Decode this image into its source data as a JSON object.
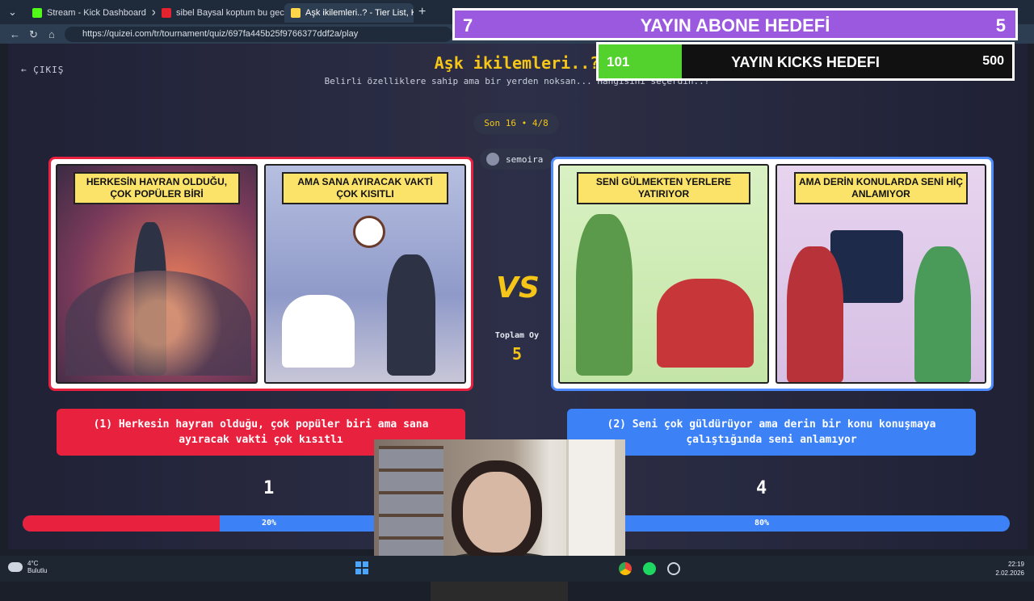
{
  "browser": {
    "tabs": [
      {
        "label": "Stream - Kick Dashboard",
        "active": false,
        "icon_color": "#53fc18"
      },
      {
        "label": "sibel Baysal koptum bu gece - You",
        "active": false,
        "icon_color": "#e5232e"
      },
      {
        "label": "Aşk ikilemleri..? - Tier List, Kör Sıral",
        "active": true,
        "icon_color": "#ffd54a"
      }
    ],
    "url": "https://quizei.com/tr/tournament/quiz/697fa445b25f9766377ddf2a/play"
  },
  "quiz": {
    "back_label": "ÇIKIŞ",
    "title": "Aşk ikilemleri..?",
    "subtitle": "Belirli özelliklere sahip ama bir yerden noksan... Hangisini seçerdin..?",
    "round": "Son 16 • 4/8",
    "username": "semoira",
    "total_votes_label": "Toplam Oy",
    "total_votes": "5",
    "vs": "VS",
    "left": {
      "panel_a_caption": "HERKESİN HAYRAN OLDUĞU, ÇOK POPÜLER BİRİ",
      "panel_b_caption": "AMA SANA AYIRACAK VAKTİ ÇOK KISITLI",
      "button_label": "(1) Herkesin hayran olduğu, çok popüler biri ama sana ayıracak vakti çok kısıtlı",
      "votes": "1",
      "percent_label": "20%",
      "color": "#e8213f"
    },
    "right": {
      "panel_a_caption": "SENİ GÜLMEKTEN YERLERE YATIRIYOR",
      "panel_b_caption": "AMA DERİN KONULARDA SENİ HİÇ ANLAMIYOR",
      "button_label": "(2) Seni çok güldürüyor ama derin bir konu konuşmaya çalıştığında seni anlamıyor",
      "votes": "4",
      "percent_label": "80%",
      "color": "#3c82f6"
    },
    "left_share": 0.2
  },
  "overlays": {
    "sub_goal": {
      "current": "7",
      "title": "YAYIN ABONE HEDEFİ",
      "target": "5",
      "color": "#9b59e0"
    },
    "kicks_goal": {
      "current": "101",
      "title": "YAYIN KICKS HEDEFI",
      "target": "500",
      "progress": 0.202,
      "color": "#53d22e"
    }
  },
  "taskbar": {
    "temperature": "4°C",
    "weather": "Bulutlu",
    "time": "22:19",
    "date": "2.02.2026"
  }
}
